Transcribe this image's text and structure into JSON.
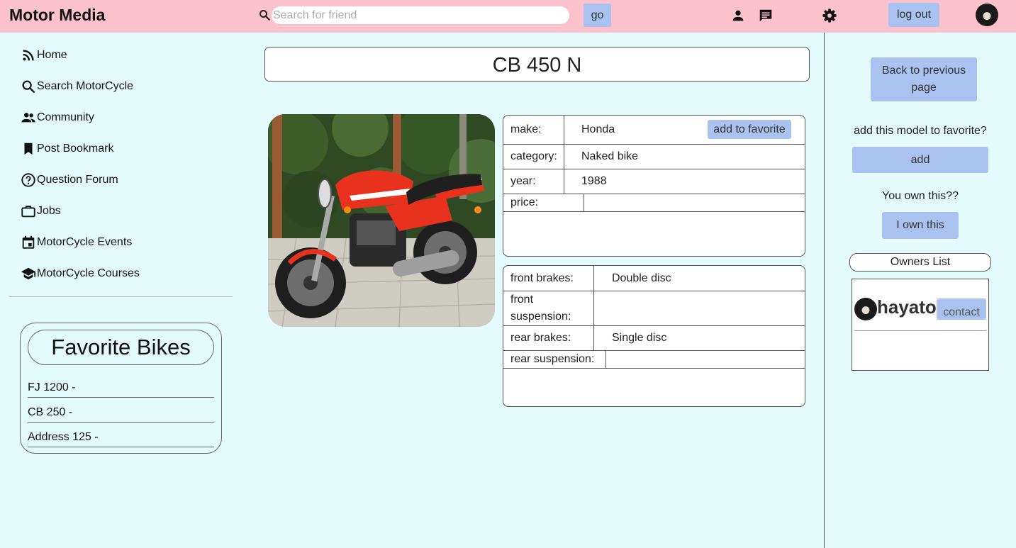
{
  "header": {
    "brand": "Motor Media",
    "search_placeholder": "Search for friend",
    "search_value": "",
    "go_label": "go",
    "logout_label": "log out",
    "icons": [
      "search-icon",
      "person-icon",
      "chat-icon",
      "gear-icon"
    ]
  },
  "sidebar": {
    "items": [
      {
        "label": "Home",
        "icon": "rss-icon"
      },
      {
        "label": "Search MotorCycle",
        "icon": "search-icon"
      },
      {
        "label": "Community",
        "icon": "people-icon"
      },
      {
        "label": "Post Bookmark",
        "icon": "bookmark-icon"
      },
      {
        "label": "Question Forum",
        "icon": "question-circle-icon"
      },
      {
        "label": "Jobs",
        "icon": "briefcase-icon"
      },
      {
        "label": "MotorCycle Events",
        "icon": "calendar-icon"
      },
      {
        "label": "MotorCycle Courses",
        "icon": "graduation-cap-icon"
      }
    ],
    "favorites": {
      "title": "Favorite Bikes",
      "items": [
        "FJ 1200 -",
        "CB 250 -",
        "Address 125 -"
      ]
    }
  },
  "main": {
    "title": "CB 450 N",
    "specs": {
      "make_label": "make:",
      "make_value": "Honda",
      "add_favorite_label": "add to favorite",
      "category_label": "category:",
      "category_value": "Naked bike",
      "year_label": "year:",
      "year_value": "1988",
      "price_label": "price:",
      "price_value": ""
    },
    "components": {
      "front_brakes_label": "front brakes:",
      "front_brakes_value": "Double disc",
      "front_suspension_label_1": "front",
      "front_suspension_label_2": "suspension:",
      "front_suspension_value": "",
      "rear_brakes_label": "rear brakes:",
      "rear_brakes_value": "Single disc",
      "rear_suspension_label": "rear suspension:",
      "rear_suspension_value": ""
    }
  },
  "right_panel": {
    "back_label_1": "Back to previous",
    "back_label_2": "page",
    "add_prompt": "add this model to favorite?",
    "add_label": "add",
    "own_prompt": "You own this??",
    "own_label": "I own this",
    "owners_title": "Owners List",
    "owners": [
      {
        "name": "hayato",
        "contact_label": "contact"
      }
    ]
  },
  "colors": {
    "header_bg": "#fbc1cc",
    "page_bg": "#e4fbfc",
    "button_bg": "#a9c2ef",
    "bike_red": "#e8321e"
  }
}
